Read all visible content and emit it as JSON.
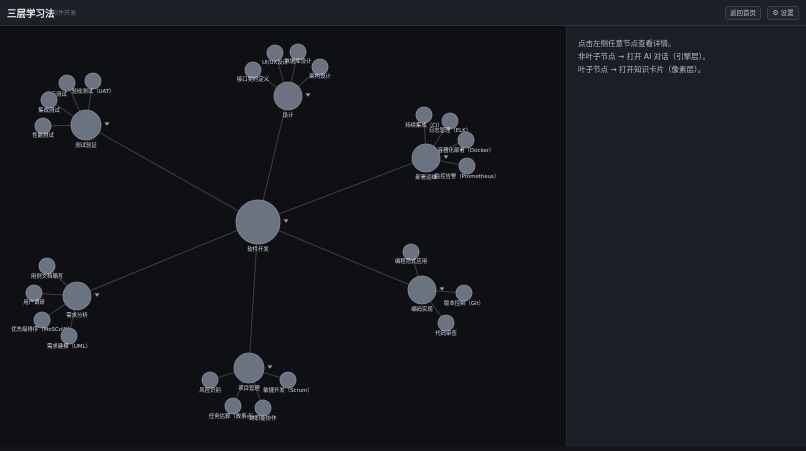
{
  "header": {
    "title": "三层学习法",
    "subtitle": "软件开发",
    "home_button": "返回首页",
    "settings_button": "设置",
    "settings_icon": "gear-icon"
  },
  "panel": {
    "lines": [
      "点击左侧任意节点查看详情。",
      "非叶子节点 → 打开 AI 对话（引擎层）。",
      "叶子节点 → 打开知识卡片（像素层）。"
    ]
  },
  "colors": {
    "node_fill": "#6b7280",
    "edge": "#3b3f4a",
    "label": "#d5d8de"
  },
  "graph": {
    "root": {
      "id": "root",
      "label": "软件开发",
      "expandable": true
    },
    "branches": [
      {
        "id": "design",
        "label": "设计",
        "expandable": true,
        "leaves": [
          "UI/UX设计",
          "数据库设计",
          "接口契约定义",
          "架构设计"
        ]
      },
      {
        "id": "testing",
        "label": "测试验证",
        "expandable": true,
        "leaves": [
          "单元测试",
          "验收测试（UAT）",
          "集成测试",
          "性能测试"
        ]
      },
      {
        "id": "devops",
        "label": "部署运维",
        "expandable": true,
        "leaves": [
          "持续集成（CI）",
          "日志管理（ELK）",
          "容器化部署（Docker）",
          "监控告警（Prometheus）"
        ]
      },
      {
        "id": "requirements",
        "label": "需求分析",
        "expandable": true,
        "leaves": [
          "用例文档编写",
          "用户调研",
          "优先级排序（MoSCoW）",
          "需求建模（UML）"
        ]
      },
      {
        "id": "coding",
        "label": "编码实现",
        "expandable": true,
        "leaves": [
          "编程范式应用",
          "版本控制（Git）",
          "代码审查"
        ]
      },
      {
        "id": "pm",
        "label": "项目管理",
        "expandable": true,
        "leaves": [
          "风险识别",
          "敏捷开发（Scrum）",
          "任务估算（故事点）",
          "跨职能协作"
        ]
      }
    ]
  }
}
